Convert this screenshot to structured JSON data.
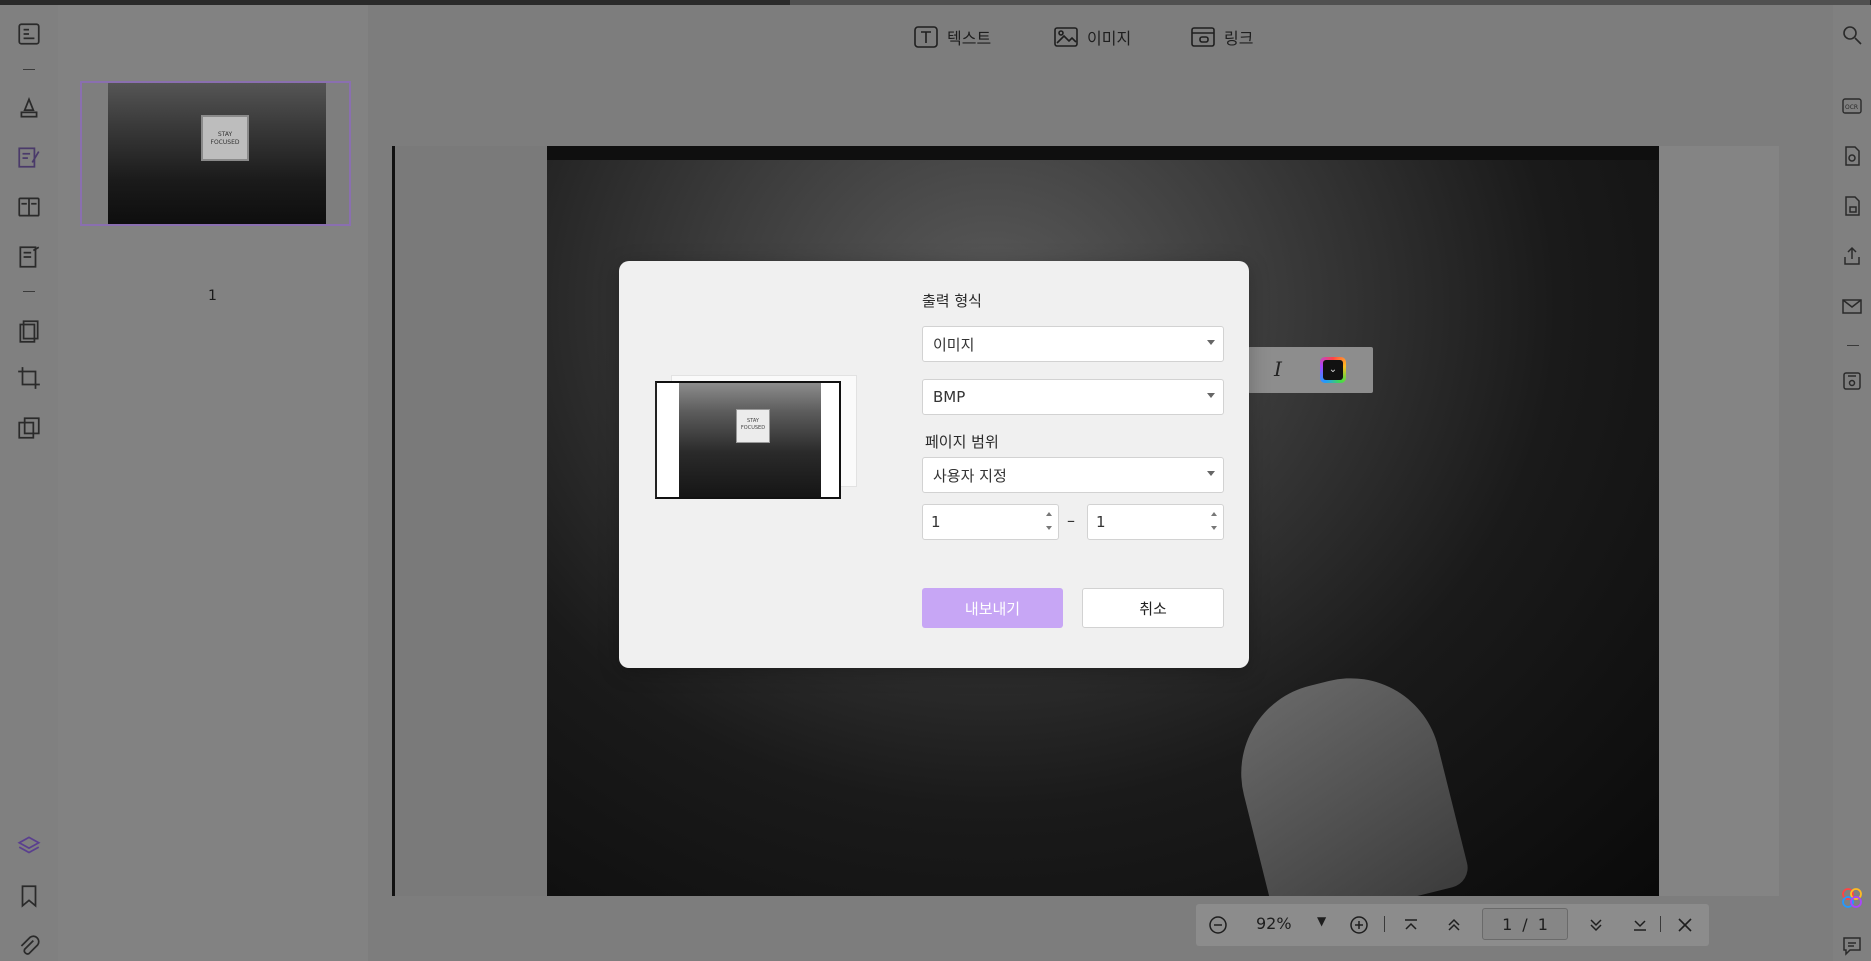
{
  "toolbar": {
    "text_label": "텍스트",
    "image_label": "이미지",
    "link_label": "링크"
  },
  "thumbnails": {
    "page_number": "1",
    "card_text": "STAY FOCUSED"
  },
  "dialog": {
    "output_format_label": "출력 형식",
    "output_format_value": "이미지",
    "image_type_value": "BMP",
    "page_range_label": "페이지 범위",
    "page_range_value": "사용자 지정",
    "range_from": "1",
    "range_to": "1",
    "range_separator": "–",
    "export_button": "내보내기",
    "cancel_button": "취소",
    "preview_card_text": "STAY FOCUSED"
  },
  "bottom_bar": {
    "zoom_value": "92%",
    "current_page": "1",
    "page_separator": "/",
    "total_pages": "1"
  },
  "colors": {
    "accent": "#c7a6f5",
    "thumbnail_border": "#8a6fb0"
  }
}
